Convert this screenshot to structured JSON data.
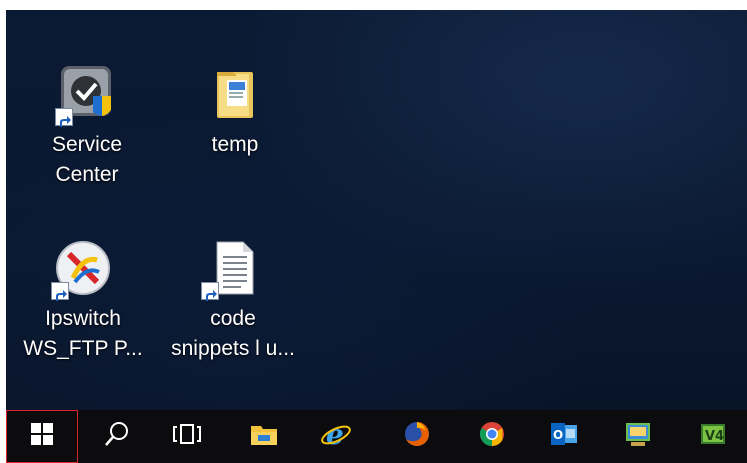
{
  "desktop": {
    "icons": [
      {
        "label": "Service\nCenter",
        "icon": "service-center-icon"
      },
      {
        "label": "temp",
        "icon": "folder-icon"
      },
      {
        "label": "Ipswitch\nWS_FTP P...",
        "icon": "ipswitch-ftp-icon"
      },
      {
        "label": "code\nsnippets l u...",
        "icon": "text-document-icon"
      }
    ]
  },
  "taskbar": {
    "buttons": [
      {
        "name": "start-button",
        "icon": "windows-logo-icon"
      },
      {
        "name": "search-button",
        "icon": "search-icon"
      },
      {
        "name": "task-view-button",
        "icon": "task-view-icon"
      },
      {
        "name": "file-explorer-button",
        "icon": "file-explorer-icon"
      },
      {
        "name": "internet-explorer-button",
        "icon": "internet-explorer-icon"
      },
      {
        "name": "firefox-button",
        "icon": "firefox-icon"
      },
      {
        "name": "chrome-button",
        "icon": "chrome-icon"
      },
      {
        "name": "outlook-button",
        "icon": "outlook-icon"
      },
      {
        "name": "app-button",
        "icon": "app-window-icon"
      },
      {
        "name": "vim-button",
        "icon": "vim-icon"
      }
    ],
    "colors": {
      "start_outline": "#d8262b",
      "taskbar_bg": "#0c0c0e",
      "desktop_bg": "#0b1a33"
    }
  }
}
